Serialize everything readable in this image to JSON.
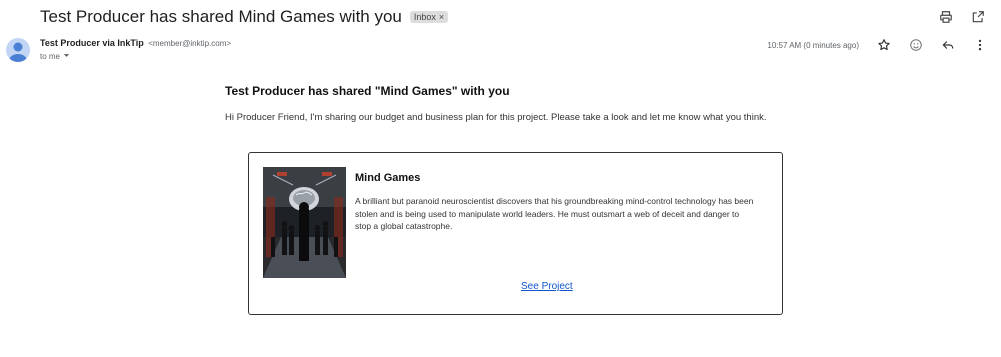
{
  "email": {
    "subject": "Test Producer has shared Mind Games with you",
    "label_chip": "Inbox",
    "label_remove": "×",
    "sender_name": "Test Producer via InkTip",
    "sender_email": "<member@inktip.com>",
    "recipient": "to me",
    "timestamp": "10:57 AM (0 minutes ago)"
  },
  "body": {
    "heading": "Test Producer has shared \"Mind Games\" with you",
    "message": "Hi Producer Friend, I'm sharing our budget and business plan for this project. Please take a look and let me know what you think."
  },
  "project": {
    "title": "Mind Games",
    "description": "A brilliant but paranoid neuroscientist discovers that his groundbreaking mind-control technology has been stolen and is being used to manipulate world leaders. He must outsmart a web of deceit and danger to stop a global catastrophe.",
    "link_label": "See Project"
  },
  "icons": {
    "print": "print-icon",
    "open_new_window": "open-in-new-window-icon",
    "star": "star-icon",
    "emoji": "emoji-icon",
    "reply": "reply-icon",
    "more": "more-vert-icon",
    "dropdown": "chevron-down-icon"
  },
  "colors": {
    "link": "#1155cc",
    "avatar_bg": "#c2d5f4",
    "avatar_fg": "#4a7fd4"
  }
}
